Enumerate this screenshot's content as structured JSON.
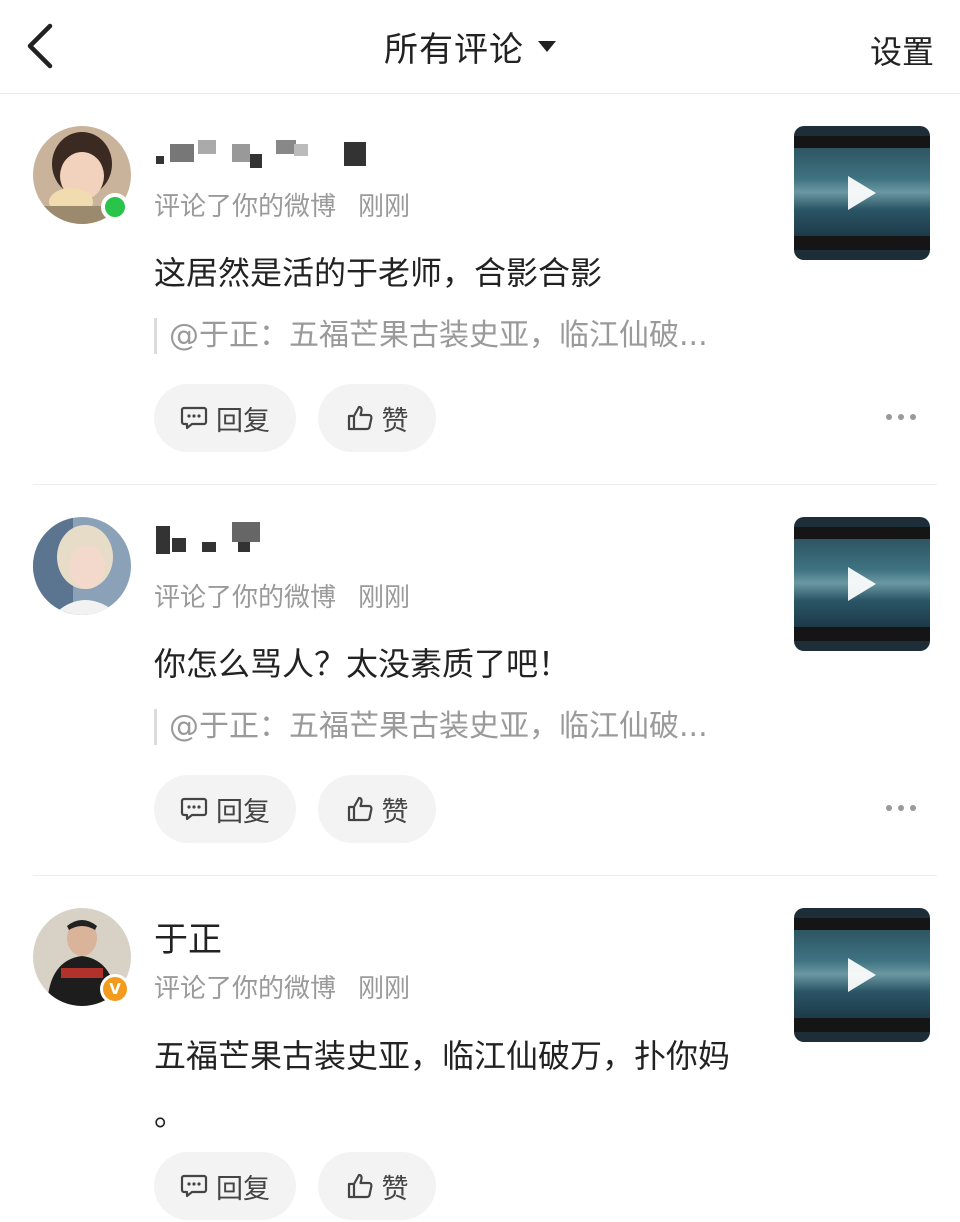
{
  "header": {
    "title": "所有评论",
    "settings_label": "设置"
  },
  "reply_label": "回复",
  "like_label": "赞",
  "comments": [
    {
      "user": "",
      "user_masked": true,
      "badge": "online",
      "meta": "评论了你的微博",
      "time": "刚刚",
      "content": "这居然是活的于老师，合影合影",
      "quote": "@于正：五福芒果古装史亚，临江仙破..."
    },
    {
      "user": "",
      "user_masked": true,
      "badge": "none",
      "meta": "评论了你的微博",
      "time": "刚刚",
      "content": "你怎么骂人？太没素质了吧！",
      "quote": "@于正：五福芒果古装史亚，临江仙破..."
    },
    {
      "user": "于正",
      "user_masked": false,
      "badge": "verified",
      "badge_text": "V",
      "meta": "评论了你的微博",
      "time": "刚刚",
      "content_line1": "五福芒果古装史亚，临江仙破万，扑你妈",
      "content_line2": "。"
    }
  ],
  "colors": {
    "online_badge": "#2bc44a",
    "verified_badge": "#f29b1c",
    "meta_text": "#9a9a9a",
    "pill_bg": "#f3f3f3"
  },
  "icons": [
    "back-arrow-icon",
    "dropdown-caret-icon",
    "comment-bubble-icon",
    "thumbs-up-icon",
    "more-dots-icon",
    "play-icon"
  ]
}
